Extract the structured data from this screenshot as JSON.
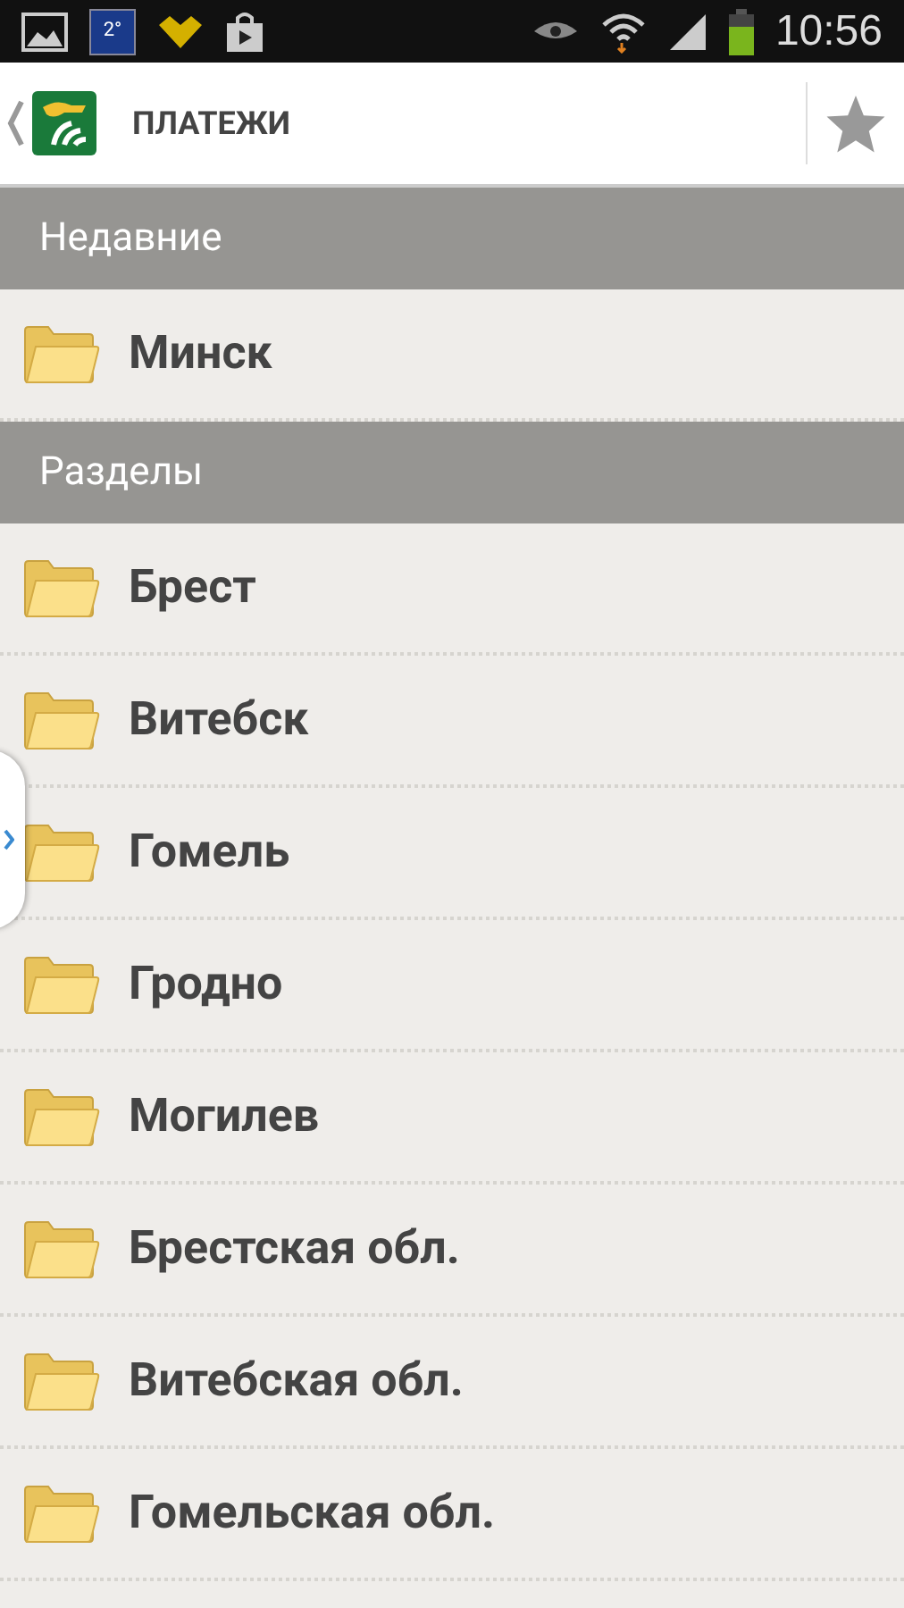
{
  "status_bar": {
    "weather": "2°",
    "time": "10:56"
  },
  "header": {
    "title": "ПЛАТЕЖИ"
  },
  "sections": [
    {
      "title": "Недавние",
      "items": [
        {
          "label": "Минск"
        }
      ]
    },
    {
      "title": "Разделы",
      "items": [
        {
          "label": "Брест"
        },
        {
          "label": "Витебск"
        },
        {
          "label": "Гомель"
        },
        {
          "label": "Гродно"
        },
        {
          "label": "Могилев"
        },
        {
          "label": "Брестская обл."
        },
        {
          "label": "Витебская обл."
        },
        {
          "label": "Гомельская обл."
        }
      ]
    }
  ]
}
